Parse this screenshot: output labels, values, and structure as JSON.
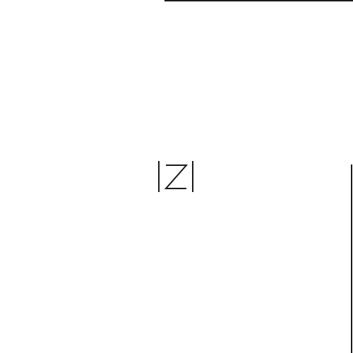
{
  "splash": {
    "logo_letter": "Z",
    "colors": {
      "background": "#ffffff",
      "logo_stroke": "#1a1a1a",
      "frame_line": "#1a1a1a"
    }
  }
}
